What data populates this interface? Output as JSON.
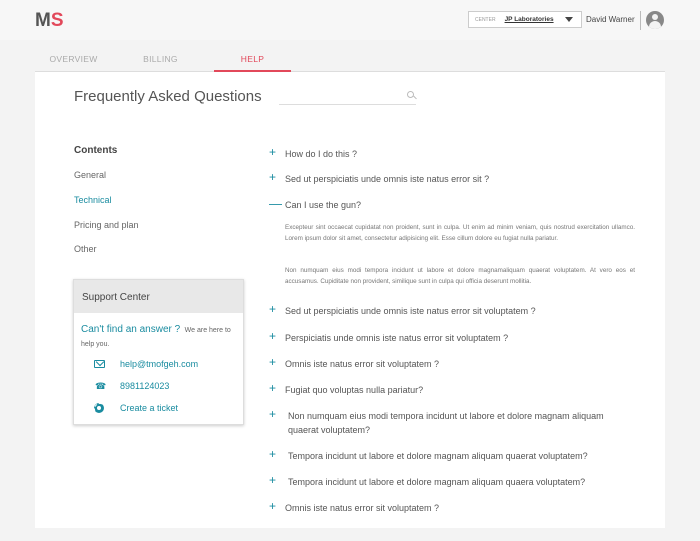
{
  "header": {
    "logo_m": "M",
    "logo_s": "S",
    "center_label": "CENTER",
    "center_value": "JP Laboratories",
    "user_name": "David Warner"
  },
  "tabs": [
    {
      "label": "OVERVIEW"
    },
    {
      "label": "BILLING"
    },
    {
      "label": "HELP",
      "active": true
    }
  ],
  "page": {
    "title": "Frequently Asked Questions",
    "search_placeholder": ""
  },
  "contents": {
    "title": "Contents",
    "items": [
      {
        "label": "General"
      },
      {
        "label": "Technical",
        "active": true
      },
      {
        "label": "Pricing and plan"
      },
      {
        "label": "Other"
      }
    ]
  },
  "support": {
    "title": "Support Center",
    "question": "Can't find an answer ?",
    "note": "We are here to help you.",
    "email": "help@tmofgeh.com",
    "phone": "8981124023",
    "ticket": "Create a ticket"
  },
  "faq": {
    "items": [
      {
        "q": "How do I do this ?",
        "open": false
      },
      {
        "q": "Sed ut perspiciatis unde omnis iste natus error sit ?",
        "open": false
      },
      {
        "q": "Can I use the gun?",
        "open": true
      },
      {
        "q": "Sed ut perspiciatis unde omnis iste natus error sit voluptatem ?",
        "open": false
      },
      {
        "q": "Perspiciatis unde omnis iste natus error sit voluptatem ?",
        "open": false
      },
      {
        "q": "Omnis iste natus error sit voluptatem ?",
        "open": false
      },
      {
        "q": "Fugiat quo voluptas nulla pariatur?",
        "open": false
      },
      {
        "q": "Non numquam eius modi tempora incidunt ut labore et dolore magnam aliquam quaerat voluptatem?",
        "open": false
      },
      {
        "q": "Tempora incidunt ut labore et dolore magnam aliquam quaerat voluptatem?",
        "open": false
      },
      {
        "q": "Tempora incidunt ut labore et dolore magnam aliquam quaera voluptatem?",
        "open": false
      },
      {
        "q": "Omnis iste natus error sit voluptatem ?",
        "open": false
      }
    ],
    "answer_p1": "Excepteur sint occaecat cupidatat non proident, sunt in culpa. Ut enim ad minim veniam, quis nostrud exercitation ullamco. Lorem ipsum dolor sit amet, consectetur adipisicing elit. Esse cillum dolore eu fugiat nulla pariatur.",
    "answer_p2": "Non numquam eius modi tempora incidunt ut labore et dolore magnamaliquam quaerat voluptatem. At vero eos et accusamus. Cupiditate non provident, similique sunt in culpa qui officia deserunt mollitia."
  },
  "colors": {
    "accent": "#1a8ca0",
    "brand": "#e2485a"
  }
}
